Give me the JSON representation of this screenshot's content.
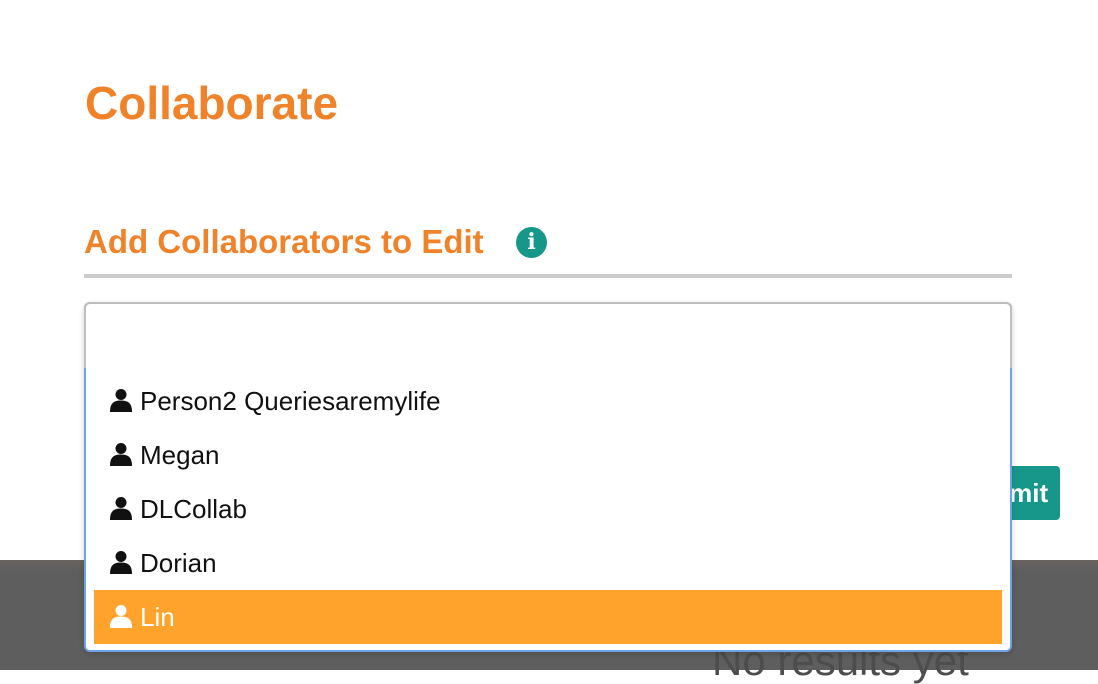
{
  "modal": {
    "title": "Collaborate",
    "section_title": "Add Collaborators to Edit",
    "submit_label": "Submit"
  },
  "collaborator_select": {
    "search_value": "",
    "options": [
      {
        "label": "Person2 Queriesaremylife",
        "icon": "user-icon",
        "highlighted": false
      },
      {
        "label": "Megan",
        "icon": "user-icon",
        "highlighted": false
      },
      {
        "label": "DLCollab",
        "icon": "user-icon",
        "highlighted": false
      },
      {
        "label": "Dorian",
        "icon": "user-icon",
        "highlighted": false
      },
      {
        "label": "Lin",
        "icon": "user-icon",
        "highlighted": true
      }
    ]
  },
  "background": {
    "empty_text": "No results yet"
  },
  "colors": {
    "accent_orange": "#f0822a",
    "teal": "#17978a",
    "highlight": "#ffa32c",
    "focus_border": "#6fa3e8"
  }
}
